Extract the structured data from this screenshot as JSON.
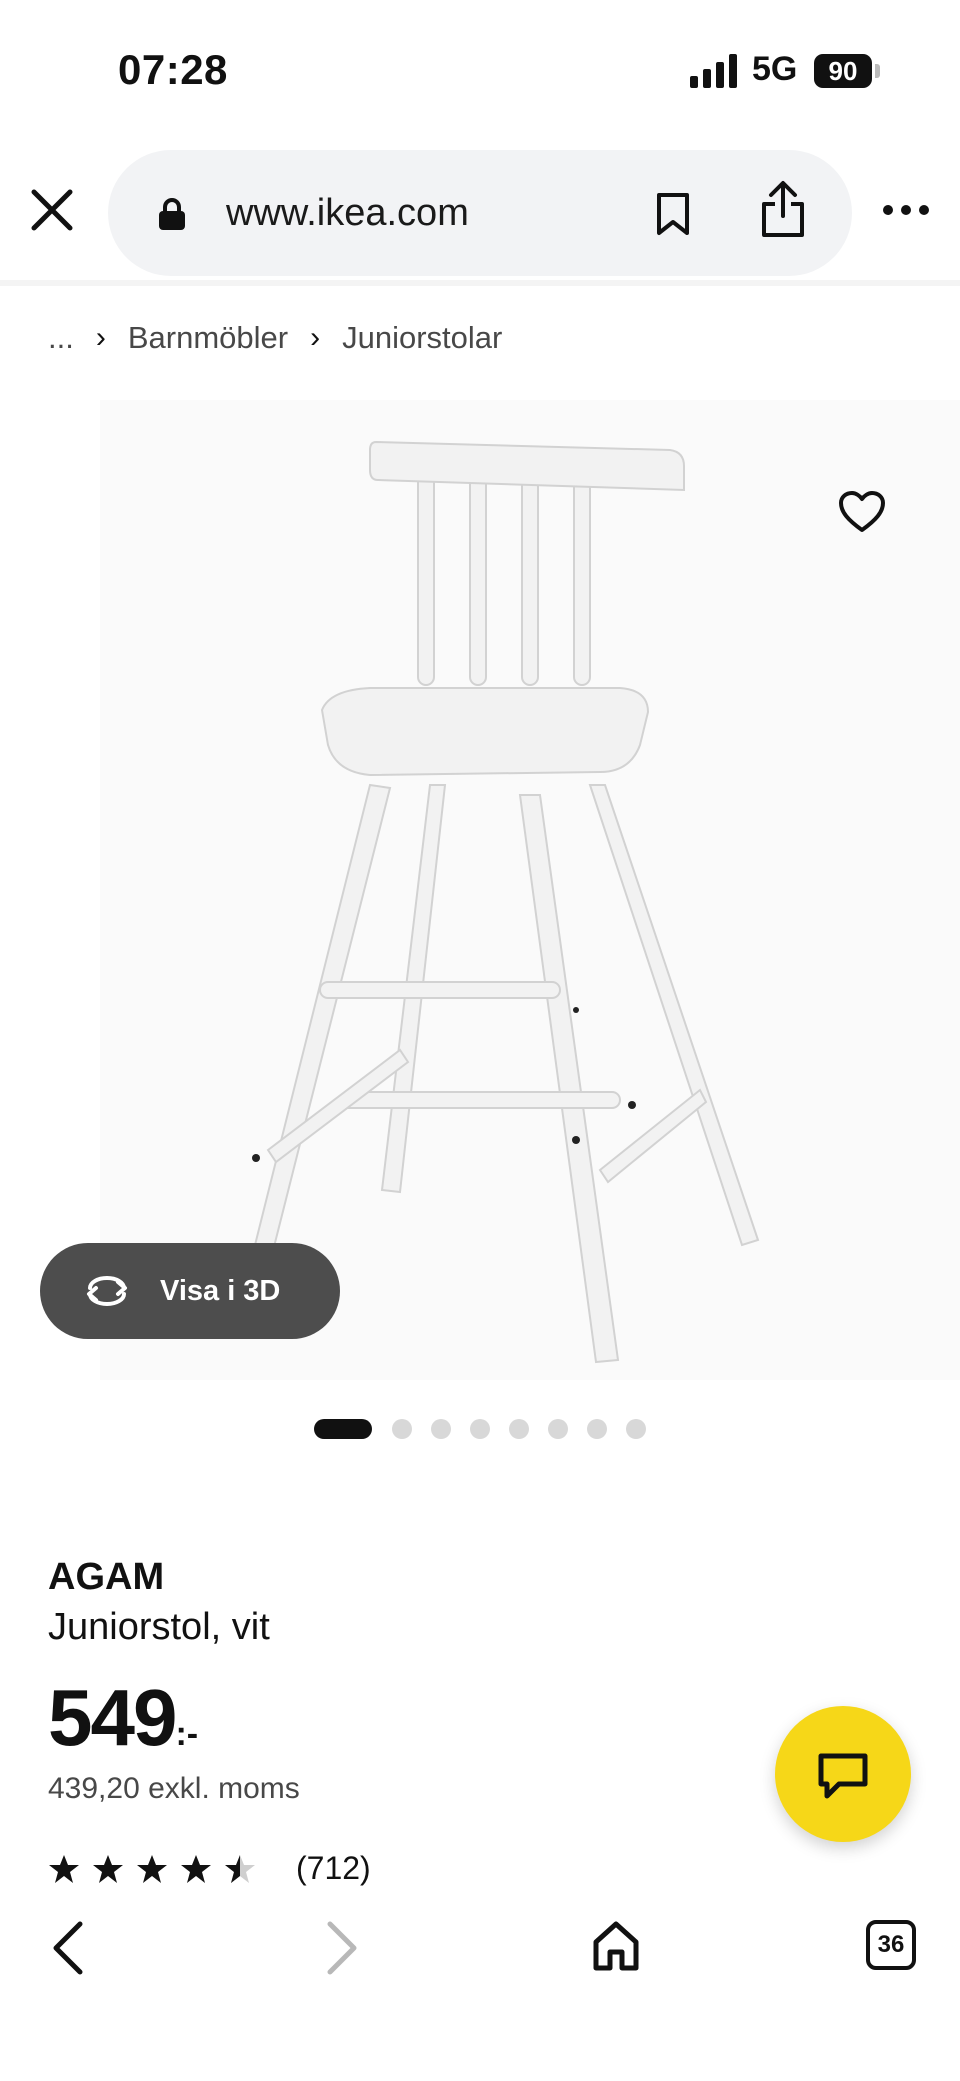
{
  "status": {
    "time": "07:28",
    "network": "5G",
    "battery": "90"
  },
  "browser": {
    "url": "www.ikea.com"
  },
  "breadcrumb": {
    "ellipsis": "...",
    "items": [
      "Barnmöbler",
      "Juniorstolar"
    ]
  },
  "gallery": {
    "view3d_label": "Visa i 3D",
    "total_images": 8,
    "active_index": 0
  },
  "product": {
    "brand": "AGAM",
    "description": "Juniorstol, vit",
    "price": "549",
    "price_suffix": ":-",
    "price_excl_vat": "439,20 exkl. moms",
    "rating_stars": 4.5,
    "rating_count": "(712)"
  },
  "bottom_nav": {
    "tabs_count": "36"
  },
  "colors": {
    "chat_fab": "#f6d718",
    "view3d_bg": "#4d4d4d",
    "url_pill": "#f2f3f5"
  }
}
